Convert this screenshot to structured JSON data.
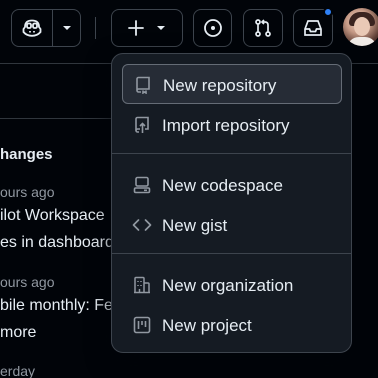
{
  "header": {
    "copilot_icon": "copilot-icon",
    "copilot_menu_icon": "chevron-down-icon",
    "create_icon": "plus-icon",
    "create_menu_icon": "chevron-down-icon",
    "issues_icon": "issue-opened-icon",
    "pulls_icon": "git-pull-request-icon",
    "inbox_icon": "inbox-icon",
    "notification_color": "#2f81f7"
  },
  "background": {
    "heading": "hanges",
    "items": [
      {
        "time": "ours ago",
        "lines": [
          "ilot Workspace",
          "es in dashboard"
        ]
      },
      {
        "time": "ours ago",
        "lines": [
          "bile monthly: Fe",
          "more"
        ]
      },
      {
        "time": "erday",
        "lines": []
      }
    ]
  },
  "create_menu": {
    "groups": [
      [
        {
          "label": "New repository",
          "icon": "repo-icon",
          "active": true
        },
        {
          "label": "Import repository",
          "icon": "repo-push-icon",
          "active": false
        }
      ],
      [
        {
          "label": "New codespace",
          "icon": "codespaces-icon",
          "active": false
        },
        {
          "label": "New gist",
          "icon": "code-icon",
          "active": false
        }
      ],
      [
        {
          "label": "New organization",
          "icon": "organization-icon",
          "active": false
        },
        {
          "label": "New project",
          "icon": "project-icon",
          "active": false
        }
      ]
    ]
  }
}
